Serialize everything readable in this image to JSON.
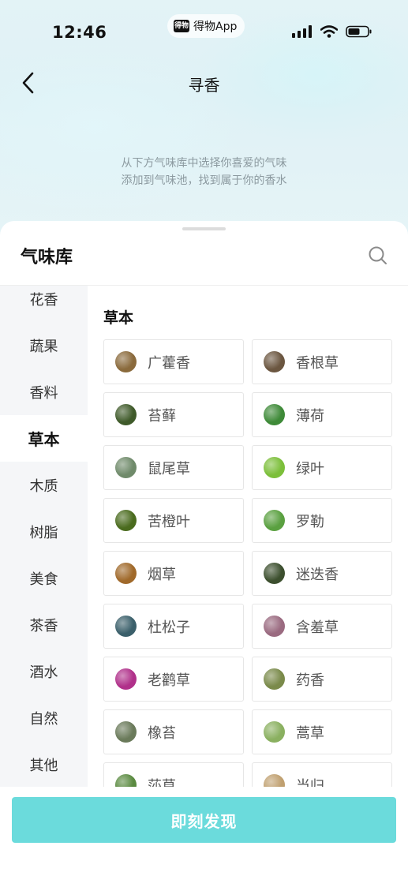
{
  "status_bar": {
    "time": "12:46",
    "app_badge": "得物App",
    "app_logo_text": "得物"
  },
  "nav": {
    "title": "寻香",
    "back_icon": "chevron-left-icon"
  },
  "hint": {
    "line1": "从下方气味库中选择你喜爱的气味",
    "line2": "添加到气味池，找到属于你的香水"
  },
  "library": {
    "title": "气味库",
    "search_icon": "search-icon",
    "categories": [
      "花香",
      "蔬果",
      "香料",
      "草本",
      "木质",
      "树脂",
      "美食",
      "茶香",
      "酒水",
      "自然",
      "其他"
    ],
    "active_category": "草本",
    "section_title": "草本",
    "items": [
      {
        "label": "广藿香",
        "color": "#8a6a3c"
      },
      {
        "label": "香根草",
        "color": "#6b5640"
      },
      {
        "label": "苔藓",
        "color": "#3f5a2a"
      },
      {
        "label": "薄荷",
        "color": "#3e8a38"
      },
      {
        "label": "鼠尾草",
        "color": "#6f8a6a"
      },
      {
        "label": "绿叶",
        "color": "#7cbf3a"
      },
      {
        "label": "苦橙叶",
        "color": "#4a6b1e"
      },
      {
        "label": "罗勒",
        "color": "#5aa040"
      },
      {
        "label": "烟草",
        "color": "#a0692a"
      },
      {
        "label": "迷迭香",
        "color": "#3c4f2e"
      },
      {
        "label": "杜松子",
        "color": "#3a5f6a"
      },
      {
        "label": "含羞草",
        "color": "#9a6a80"
      },
      {
        "label": "老鹳草",
        "color": "#b0308a"
      },
      {
        "label": "药香",
        "color": "#7a8a4a"
      },
      {
        "label": "橡苔",
        "color": "#6a7a5a"
      },
      {
        "label": "蒿草",
        "color": "#8ab060"
      },
      {
        "label": "莎草",
        "color": "#5a8a40"
      },
      {
        "label": "当归",
        "color": "#c0a070"
      }
    ]
  },
  "cta": {
    "label": "即刻发现"
  }
}
